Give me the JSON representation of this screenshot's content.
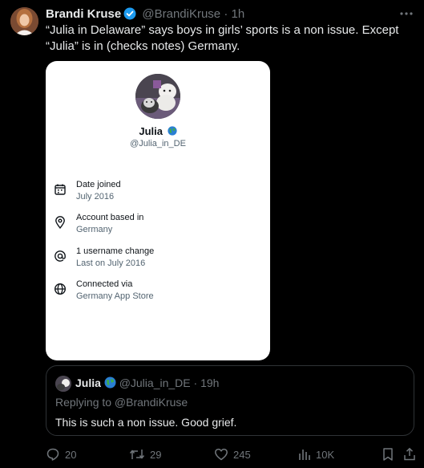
{
  "tweet": {
    "author_name": "Brandi Kruse",
    "author_handle": "@BrandiKruse",
    "separator": "·",
    "time": "1h",
    "text": "“Julia in Delaware” says boys in girls’ sports is a non issue. Except “Julia” is in (checks notes) Germany."
  },
  "card": {
    "display_name": "Julia",
    "handle": "@Julia_in_DE",
    "rows": [
      {
        "title": "Date joined",
        "value": "July 2016",
        "icon": "calendar-icon"
      },
      {
        "title": "Account based in",
        "value": "Germany",
        "icon": "location-pin-icon"
      },
      {
        "title": "1 username change",
        "value": "Last on July 2016",
        "icon": "at-sign-icon"
      },
      {
        "title": "Connected via",
        "value": "Germany App Store",
        "icon": "globe-icon"
      }
    ]
  },
  "quote": {
    "name": "Julia",
    "handle": "@Julia_in_DE",
    "separator": "·",
    "time": "19h",
    "replying": "Replying to @BrandiKruse",
    "text": "This is such a non issue. Good grief."
  },
  "actions": {
    "replies": "20",
    "reposts": "29",
    "likes": "245",
    "views": "10K"
  },
  "colors": {
    "background": "#000000",
    "text": "#e7e9ea",
    "muted": "#71767b",
    "verified": "#1d9bf0",
    "card_bg": "#ffffff"
  }
}
